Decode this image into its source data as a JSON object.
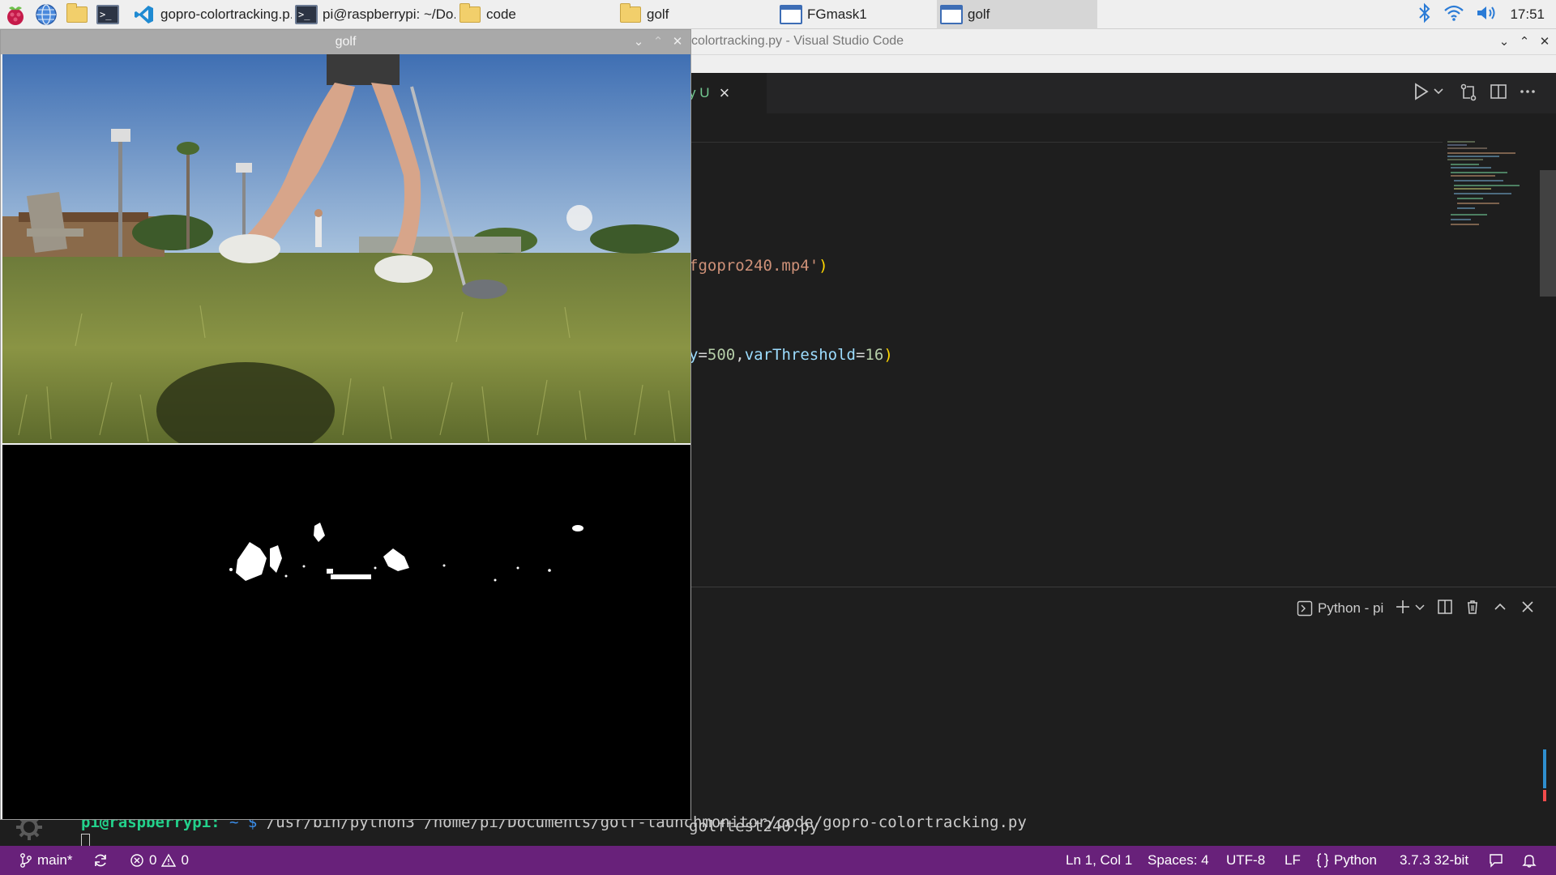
{
  "taskbar": {
    "launchers": [
      "raspberry-menu-icon",
      "web-browser-icon",
      "file-manager-icon",
      "terminal-icon"
    ],
    "tasks": [
      {
        "label": "gopro-colortracking.p...",
        "icon": "vscode-icon"
      },
      {
        "label": "pi@raspberrypi: ~/Do...",
        "icon": "terminal-icon"
      },
      {
        "label": "code",
        "icon": "folder-icon"
      },
      {
        "label": "golf",
        "icon": "folder-icon"
      },
      {
        "label": "FGmask1",
        "icon": "window-icon"
      },
      {
        "label": "golf",
        "icon": "window-icon"
      }
    ],
    "clock": "17:51"
  },
  "vscode": {
    "title": "colortracking.py - Visual Studio Code",
    "tab": {
      "badge": "y U",
      "close": "×"
    },
    "code_lines": [
      {
        "str": "fgopro240.mp4'",
        "paren": ")"
      },
      {
        "p1": "y",
        "v1": "500",
        "p2": "varThreshold",
        "v2": "16",
        "paren": ")"
      }
    ],
    "panel": {
      "shell_label": "Python - pi",
      "output_line": "golftest240.py",
      "prompt_user": "pi@raspberrypi:",
      "prompt_path": " ~ $",
      "prompt_cmd": " /usr/bin/python3 /home/pi/Documents/golf-launchmonitor/code/gopro-colortracking.py"
    },
    "statusbar": {
      "branch": "main*",
      "errors": "0",
      "warnings": "0",
      "position": "Ln 1, Col 1",
      "spaces": "Spaces: 4",
      "encoding": "UTF-8",
      "eol": "LF",
      "language": "Python",
      "interpreter": "3.7.3 32-bit"
    }
  },
  "golf_window": {
    "title": "golf"
  },
  "colors": {
    "statusbar": "#68217a",
    "editor_bg": "#1e1e1e",
    "taskbar_bg": "#efefef"
  }
}
